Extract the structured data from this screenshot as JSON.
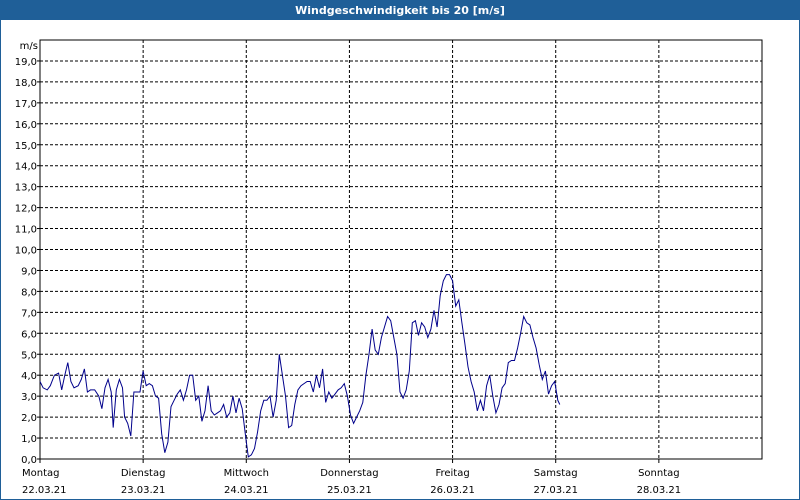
{
  "window": {
    "title": "Windgeschwindigkeit bis 20 [m/s]"
  },
  "chart_data": {
    "type": "line",
    "title": "Windgeschwindigkeit bis 20 [m/s]",
    "ylabel": "m/s",
    "ylim": [
      0,
      20
    ],
    "yticks": [
      "0,0",
      "1,0",
      "2,0",
      "3,0",
      "4,0",
      "5,0",
      "6,0",
      "7,0",
      "8,0",
      "9,0",
      "10,0",
      "11,0",
      "12,0",
      "13,0",
      "14,0",
      "15,0",
      "16,0",
      "17,0",
      "18,0",
      "19,0"
    ],
    "grid": true,
    "xlim": [
      0,
      7
    ],
    "days": [
      {
        "day": "Montag",
        "date": "22.03.21"
      },
      {
        "day": "Dienstag",
        "date": "23.03.21"
      },
      {
        "day": "Mittwoch",
        "date": "24.03.21"
      },
      {
        "day": "Donnerstag",
        "date": "25.03.21"
      },
      {
        "day": "Freitag",
        "date": "26.03.21"
      },
      {
        "day": "Samstag",
        "date": "27.03.21"
      },
      {
        "day": "Sonntag",
        "date": "28.03.21"
      }
    ],
    "series": [
      {
        "color": "#00008b",
        "points": [
          [
            0.0,
            3.7
          ],
          [
            0.03,
            3.4
          ],
          [
            0.07,
            3.3
          ],
          [
            0.1,
            3.5
          ],
          [
            0.14,
            4.0
          ],
          [
            0.18,
            4.1
          ],
          [
            0.21,
            3.3
          ],
          [
            0.24,
            4.0
          ],
          [
            0.27,
            4.6
          ],
          [
            0.3,
            3.7
          ],
          [
            0.33,
            3.4
          ],
          [
            0.37,
            3.5
          ],
          [
            0.4,
            3.8
          ],
          [
            0.43,
            4.3
          ],
          [
            0.46,
            3.2
          ],
          [
            0.49,
            3.3
          ],
          [
            0.53,
            3.3
          ],
          [
            0.57,
            3.0
          ],
          [
            0.6,
            2.4
          ],
          [
            0.63,
            3.4
          ],
          [
            0.66,
            3.8
          ],
          [
            0.69,
            3.2
          ],
          [
            0.71,
            1.5
          ],
          [
            0.74,
            3.3
          ],
          [
            0.77,
            3.8
          ],
          [
            0.8,
            3.4
          ],
          [
            0.82,
            2.0
          ],
          [
            0.85,
            1.7
          ],
          [
            0.88,
            1.1
          ],
          [
            0.91,
            3.2
          ],
          [
            0.94,
            3.2
          ],
          [
            0.97,
            3.2
          ],
          [
            1.0,
            4.2
          ],
          [
            1.03,
            3.5
          ],
          [
            1.06,
            3.6
          ],
          [
            1.09,
            3.5
          ],
          [
            1.12,
            3.0
          ],
          [
            1.15,
            2.9
          ],
          [
            1.18,
            1.2
          ],
          [
            1.21,
            0.3
          ],
          [
            1.24,
            0.8
          ],
          [
            1.27,
            2.5
          ],
          [
            1.3,
            2.8
          ],
          [
            1.33,
            3.1
          ],
          [
            1.36,
            3.3
          ],
          [
            1.39,
            2.8
          ],
          [
            1.42,
            3.3
          ],
          [
            1.45,
            4.0
          ],
          [
            1.48,
            4.0
          ],
          [
            1.51,
            2.8
          ],
          [
            1.54,
            3.0
          ],
          [
            1.57,
            1.8
          ],
          [
            1.6,
            2.3
          ],
          [
            1.63,
            3.5
          ],
          [
            1.66,
            2.3
          ],
          [
            1.69,
            2.1
          ],
          [
            1.72,
            2.2
          ],
          [
            1.75,
            2.3
          ],
          [
            1.78,
            2.6
          ],
          [
            1.81,
            2.0
          ],
          [
            1.84,
            2.2
          ],
          [
            1.87,
            3.0
          ],
          [
            1.9,
            2.2
          ],
          [
            1.93,
            2.9
          ],
          [
            1.96,
            2.4
          ],
          [
            1.99,
            1.2
          ],
          [
            2.02,
            0.1
          ],
          [
            2.05,
            0.2
          ],
          [
            2.08,
            0.5
          ],
          [
            2.11,
            1.3
          ],
          [
            2.14,
            2.3
          ],
          [
            2.17,
            2.8
          ],
          [
            2.2,
            2.8
          ],
          [
            2.23,
            3.0
          ],
          [
            2.26,
            2.0
          ],
          [
            2.29,
            2.8
          ],
          [
            2.32,
            5.0
          ],
          [
            2.35,
            4.0
          ],
          [
            2.38,
            3.0
          ],
          [
            2.41,
            1.5
          ],
          [
            2.44,
            1.6
          ],
          [
            2.47,
            2.6
          ],
          [
            2.5,
            3.3
          ],
          [
            2.53,
            3.5
          ],
          [
            2.56,
            3.6
          ],
          [
            2.59,
            3.7
          ],
          [
            2.62,
            3.7
          ],
          [
            2.65,
            3.2
          ],
          [
            2.68,
            4.0
          ],
          [
            2.71,
            3.4
          ],
          [
            2.74,
            4.3
          ],
          [
            2.77,
            2.7
          ],
          [
            2.8,
            3.2
          ],
          [
            2.83,
            2.9
          ],
          [
            2.86,
            3.1
          ],
          [
            2.89,
            3.3
          ],
          [
            2.92,
            3.4
          ],
          [
            2.95,
            3.6
          ],
          [
            2.98,
            3.0
          ],
          [
            3.01,
            2.1
          ],
          [
            3.04,
            1.7
          ],
          [
            3.07,
            2.0
          ],
          [
            3.1,
            2.3
          ],
          [
            3.13,
            2.7
          ],
          [
            3.16,
            4.0
          ],
          [
            3.19,
            5.0
          ],
          [
            3.22,
            6.2
          ],
          [
            3.25,
            5.2
          ],
          [
            3.28,
            5.0
          ],
          [
            3.31,
            5.8
          ],
          [
            3.34,
            6.3
          ],
          [
            3.37,
            6.8
          ],
          [
            3.4,
            6.6
          ],
          [
            3.43,
            5.8
          ],
          [
            3.46,
            5.0
          ],
          [
            3.49,
            3.2
          ],
          [
            3.52,
            2.9
          ],
          [
            3.55,
            3.3
          ],
          [
            3.58,
            4.2
          ],
          [
            3.61,
            6.5
          ],
          [
            3.64,
            6.6
          ],
          [
            3.67,
            5.9
          ],
          [
            3.7,
            6.5
          ],
          [
            3.73,
            6.3
          ],
          [
            3.76,
            5.8
          ],
          [
            3.79,
            6.2
          ],
          [
            3.82,
            7.1
          ],
          [
            3.85,
            6.3
          ],
          [
            3.88,
            7.8
          ],
          [
            3.91,
            8.5
          ],
          [
            3.94,
            8.8
          ],
          [
            3.97,
            8.8
          ],
          [
            4.0,
            8.5
          ],
          [
            4.03,
            7.3
          ],
          [
            4.06,
            7.6
          ],
          [
            4.09,
            6.5
          ],
          [
            4.12,
            5.5
          ],
          [
            4.15,
            4.4
          ],
          [
            4.18,
            3.7
          ],
          [
            4.21,
            3.2
          ],
          [
            4.24,
            2.3
          ],
          [
            4.27,
            2.8
          ],
          [
            4.3,
            2.3
          ],
          [
            4.33,
            3.5
          ],
          [
            4.36,
            4.0
          ],
          [
            4.39,
            3.0
          ],
          [
            4.42,
            2.2
          ],
          [
            4.45,
            2.6
          ],
          [
            4.48,
            3.4
          ],
          [
            4.51,
            3.6
          ],
          [
            4.54,
            4.6
          ],
          [
            4.57,
            4.7
          ],
          [
            4.6,
            4.7
          ],
          [
            4.63,
            5.3
          ],
          [
            4.66,
            6.0
          ],
          [
            4.69,
            6.8
          ],
          [
            4.72,
            6.5
          ],
          [
            4.75,
            6.4
          ],
          [
            4.78,
            5.8
          ],
          [
            4.81,
            5.3
          ],
          [
            4.84,
            4.5
          ],
          [
            4.87,
            3.8
          ],
          [
            4.9,
            4.2
          ],
          [
            4.93,
            3.1
          ],
          [
            4.96,
            3.5
          ],
          [
            4.99,
            3.7
          ],
          [
            5.02,
            2.8
          ],
          [
            5.04,
            2.6
          ]
        ]
      }
    ]
  }
}
